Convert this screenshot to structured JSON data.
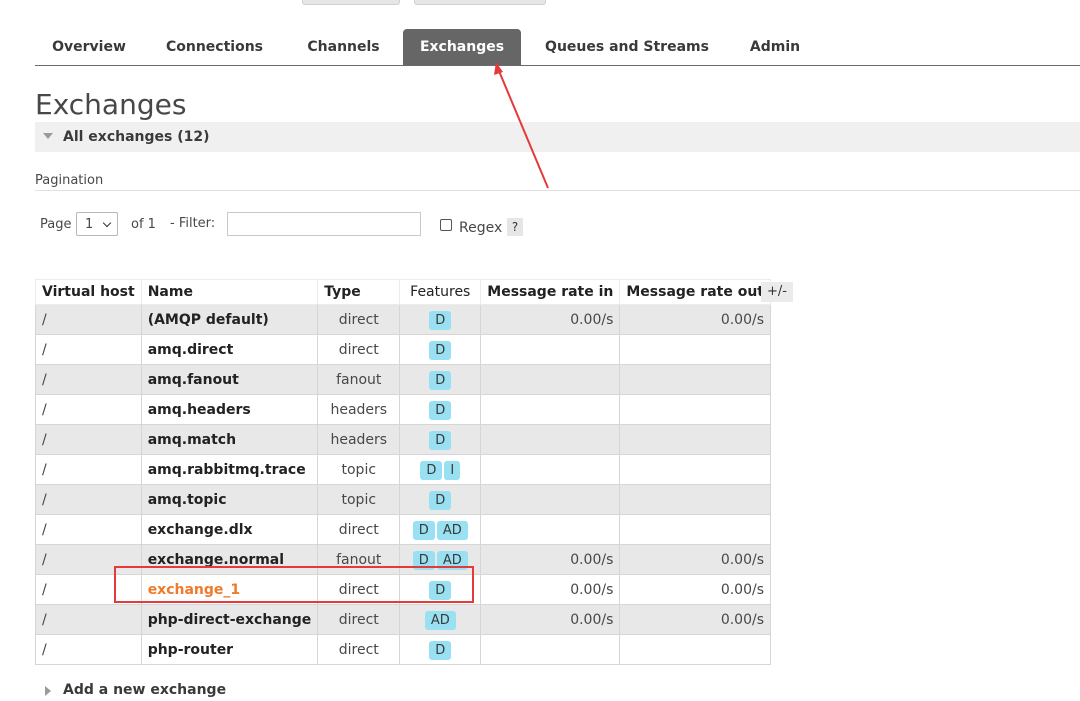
{
  "tabs": [
    {
      "label": "Overview"
    },
    {
      "label": "Connections"
    },
    {
      "label": "Channels"
    },
    {
      "label": "Exchanges",
      "active": true
    },
    {
      "label": "Queues and Streams"
    },
    {
      "label": "Admin"
    }
  ],
  "page_title": "Exchanges",
  "section": {
    "label": "All exchanges (12)"
  },
  "pagination": {
    "heading": "Pagination",
    "page_label": "Page",
    "page_value": "1",
    "of_label": "of 1",
    "filter_label": "- Filter:",
    "filter_value": "",
    "regex_label": "Regex",
    "help_label": "?"
  },
  "table": {
    "columns": [
      "Virtual host",
      "Name",
      "Type",
      "Features",
      "Message rate in",
      "Message rate out"
    ],
    "toggle_label": "+/-",
    "rows": [
      {
        "vhost": "/",
        "name": "(AMQP default)",
        "type": "direct",
        "f1": "D",
        "f2": "",
        "rate_in": "0.00/s",
        "rate_out": "0.00/s"
      },
      {
        "vhost": "/",
        "name": "amq.direct",
        "type": "direct",
        "f1": "D",
        "f2": "",
        "rate_in": "",
        "rate_out": ""
      },
      {
        "vhost": "/",
        "name": "amq.fanout",
        "type": "fanout",
        "f1": "D",
        "f2": "",
        "rate_in": "",
        "rate_out": ""
      },
      {
        "vhost": "/",
        "name": "amq.headers",
        "type": "headers",
        "f1": "D",
        "f2": "",
        "rate_in": "",
        "rate_out": ""
      },
      {
        "vhost": "/",
        "name": "amq.match",
        "type": "headers",
        "f1": "D",
        "f2": "",
        "rate_in": "",
        "rate_out": ""
      },
      {
        "vhost": "/",
        "name": "amq.rabbitmq.trace",
        "type": "topic",
        "f1": "D",
        "f2": "I",
        "rate_in": "",
        "rate_out": ""
      },
      {
        "vhost": "/",
        "name": "amq.topic",
        "type": "topic",
        "f1": "D",
        "f2": "",
        "rate_in": "",
        "rate_out": ""
      },
      {
        "vhost": "/",
        "name": "exchange.dlx",
        "type": "direct",
        "f1": "D",
        "f2": "AD",
        "rate_in": "",
        "rate_out": ""
      },
      {
        "vhost": "/",
        "name": "exchange.normal",
        "type": "fanout",
        "f1": "D",
        "f2": "AD",
        "rate_in": "0.00/s",
        "rate_out": "0.00/s"
      },
      {
        "vhost": "/",
        "name": "exchange_1",
        "type": "direct",
        "f1": "D",
        "f2": "",
        "rate_in": "0.00/s",
        "rate_out": "0.00/s",
        "highlight": true
      },
      {
        "vhost": "/",
        "name": "php-direct-exchange",
        "type": "direct",
        "f1": "AD",
        "f2": "",
        "rate_in": "0.00/s",
        "rate_out": "0.00/s"
      },
      {
        "vhost": "/",
        "name": "php-router",
        "type": "direct",
        "f1": "D",
        "f2": "",
        "rate_in": "",
        "rate_out": ""
      }
    ]
  },
  "add_new": {
    "label": "Add a new exchange"
  },
  "colors": {
    "active_tab_bg": "#666666",
    "badge_bg": "#99e0f2",
    "highlight_text": "#f07a2a",
    "annotation_red": "#e43a3a",
    "zebra_row": "#e8e8e8"
  }
}
